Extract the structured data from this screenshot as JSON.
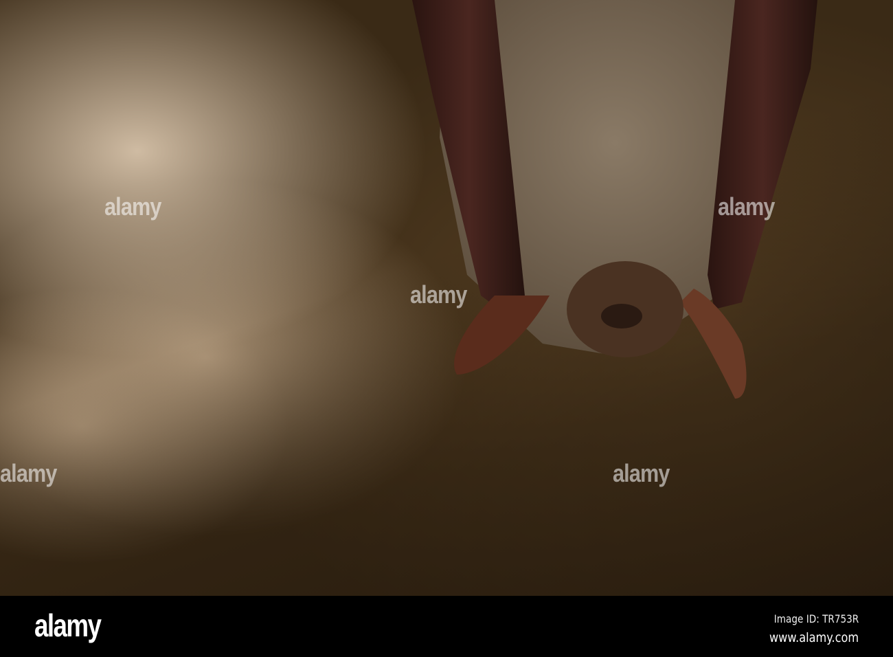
{
  "photo": {
    "subject": "bat hanging upside down on cave rock"
  },
  "watermark": {
    "text": "alamy"
  },
  "footer": {
    "logo": "alamy",
    "image_id": "Image ID: TR753R",
    "website": "www.alamy.com"
  }
}
